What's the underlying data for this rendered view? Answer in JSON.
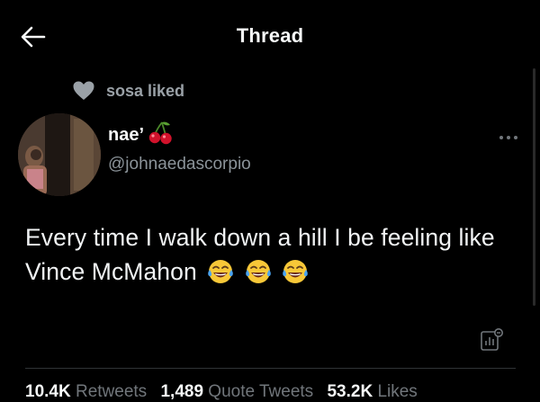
{
  "header": {
    "title": "Thread",
    "back_icon": "arrow-left-icon"
  },
  "social_context": {
    "icon": "heart-icon",
    "text": "sosa liked"
  },
  "tweet": {
    "author": {
      "display_name": "nae’",
      "name_emoji": "cherries-icon",
      "handle": "@johnaedascorpio"
    },
    "text": "Every time I walk down a hill I be feeling like Vince McMahon",
    "trailing_emojis": [
      "face-with-tears-of-joy-icon",
      "face-with-tears-of-joy-icon",
      "face-with-tears-of-joy-icon"
    ],
    "stats": {
      "retweets_count": "10.4K",
      "retweets_label": "Retweets",
      "quote_count": "1,489",
      "quote_label": "Quote Tweets",
      "likes_count": "53.2K",
      "likes_label": "Likes"
    }
  },
  "colors": {
    "background": "#000000",
    "primary_text": "#e7e9ea",
    "secondary_text": "#71767b",
    "divider": "#2f3336"
  }
}
